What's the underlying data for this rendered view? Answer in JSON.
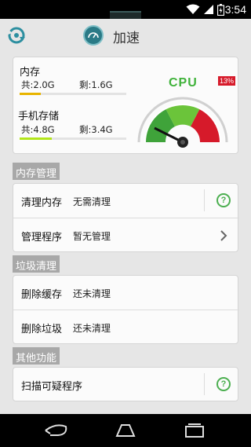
{
  "status_bar": {
    "time": "3:54",
    "icons": [
      "wifi-icon",
      "signal-icon",
      "battery-icon"
    ]
  },
  "app_bar": {
    "title": "加速",
    "icons": [
      "refresh-icon",
      "app-icon"
    ]
  },
  "memory": {
    "ram": {
      "label": "内存",
      "total": "共:2.0G",
      "remaining": "剩:1.6G",
      "usage_fraction": 0.2
    },
    "storage": {
      "label": "手机存储",
      "total": "共:4.8G",
      "remaining": "剩:3.4G",
      "usage_fraction": 0.3
    },
    "cpu": {
      "label": "CPU",
      "percent_text": "13%",
      "percent": 13
    }
  },
  "sections": {
    "memory_mgmt": {
      "title": "内存管理",
      "rows": [
        {
          "label": "清理内存",
          "status": "无需清理",
          "action_icon": "help-icon"
        },
        {
          "label": "管理程序",
          "status": "暂无管理",
          "action_icon": "chevron-right-icon"
        }
      ]
    },
    "junk_clean": {
      "title": "垃圾清理",
      "rows": [
        {
          "label": "删除缓存",
          "status": "还未清理"
        },
        {
          "label": "删除垃圾",
          "status": "还未清理"
        }
      ]
    },
    "other": {
      "title": "其他功能",
      "rows": [
        {
          "label": "扫描可疑程序",
          "action_icon": "help-icon"
        }
      ]
    }
  },
  "nav_bar": {
    "icons": [
      "back-icon",
      "home-icon",
      "recents-icon"
    ]
  },
  "colors": {
    "accent_green": "#4caf50",
    "cpu_red": "#d61a2a",
    "bar_yellow": "#e8b400",
    "bar_green": "#b3e61a"
  }
}
